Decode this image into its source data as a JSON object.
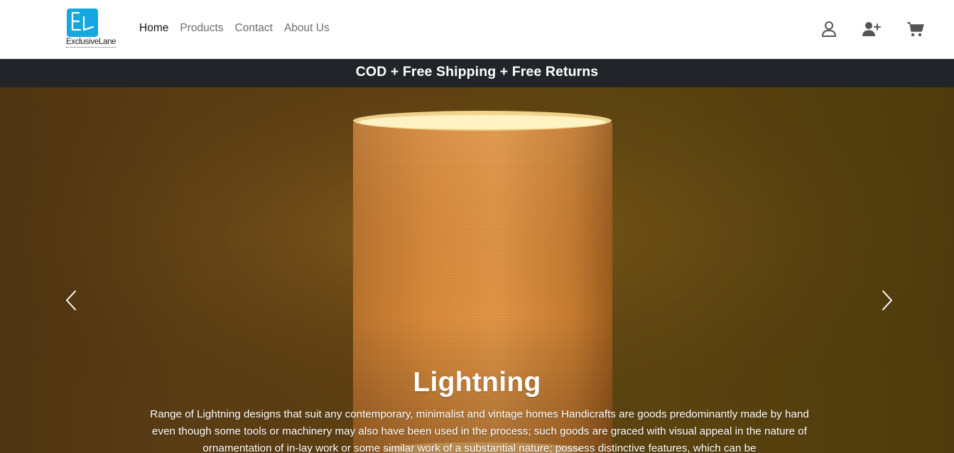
{
  "brand": {
    "name": "ExclusiveLane",
    "monogram": "EL",
    "color": "#14a7e0"
  },
  "nav": {
    "links": [
      {
        "label": "Home",
        "active": true
      },
      {
        "label": "Products",
        "active": false
      },
      {
        "label": "Contact",
        "active": false
      },
      {
        "label": "About Us",
        "active": false
      }
    ],
    "icons": [
      "user-icon",
      "user-plus-icon",
      "cart-icon"
    ]
  },
  "promo": {
    "text": "COD + Free Shipping + Free Returns",
    "background": "#212529"
  },
  "hero": {
    "title": "Lightning",
    "description": "Range of Lightning designs that suit any contemporary, minimalist and vintage homes Handicrafts are goods predominantly made by hand even though some tools or machinery may also have been used in the process; such goods are graced with visual appeal in the nature of ornamentation of in-lay work or some similar work of a substantial nature; possess distinctive features, which can be",
    "controls": [
      "chevron-left-icon",
      "chevron-right-icon"
    ]
  }
}
